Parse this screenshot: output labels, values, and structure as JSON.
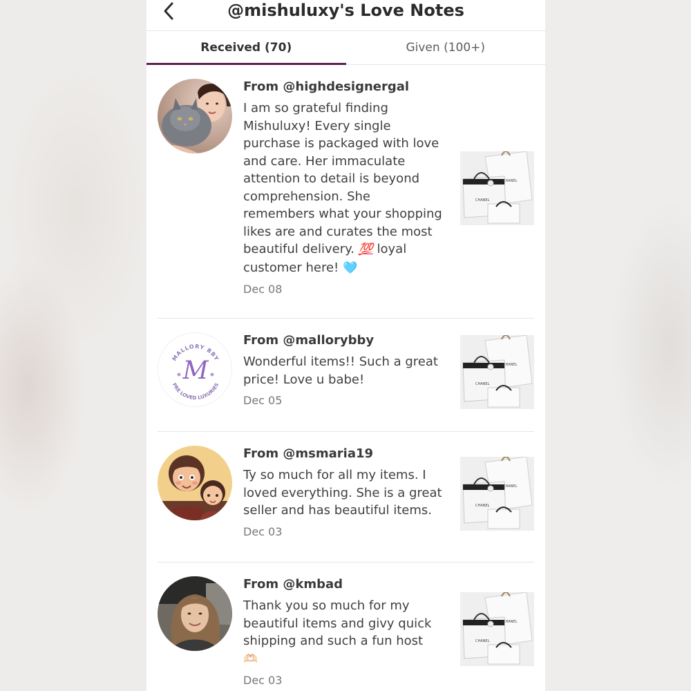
{
  "header": {
    "title": "@mishuluxy's Love Notes",
    "back_icon": "chevron-left-icon"
  },
  "tabs": [
    {
      "label": "Received (70)",
      "active": true
    },
    {
      "label": "Given (100+)",
      "active": false
    }
  ],
  "colors": {
    "accent": "#5c1f4f",
    "text": "#3f3f3f",
    "muted": "#777777"
  },
  "notes": [
    {
      "from": "From @highdesignergal",
      "message_lines": [
        "I am so grateful finding",
        "Mishuluxy! Every single",
        "purchase is packaged with love",
        "and care. Her immaculate",
        "attention to detail is beyond",
        "comprehension. She",
        "remembers what your shopping",
        "likes are and curates the most",
        "beautiful delivery. ",
        "customer here! "
      ],
      "emoji_100": "💯",
      "emoji_100_after": " loyal",
      "emoji_heart": "🩵",
      "date": "Dec 08",
      "avatar_icon": "woman-with-cat-avatar",
      "thumb_icon": "chanel-bags-photo"
    },
    {
      "from": "From @mallorybby",
      "message_lines": [
        "Wonderful items!! Such a great",
        "price! Love u babe!"
      ],
      "date": "Dec 05",
      "avatar_icon": "mallory-bby-logo-avatar",
      "avatar_logo": {
        "top": "MALLORY BBY",
        "letter": "M",
        "bottom": "PRE LOVED LUXURIES"
      },
      "thumb_icon": "chanel-bags-photo"
    },
    {
      "from": "From @msmaria19",
      "message_lines": [
        "Ty so much for all my items. I",
        "loved everything. She is a great",
        "seller and has beautiful items."
      ],
      "date": "Dec 03",
      "avatar_icon": "cartoon-mother-child-avatar",
      "thumb_icon": "chanel-bags-photo"
    },
    {
      "from": "From @kmbad",
      "message_lines": [
        "Thank you so much for my",
        "beautiful items and givy quick",
        "shipping and such a fun host"
      ],
      "emoji_hands": "🫶🏻",
      "date": "Dec 03",
      "avatar_icon": "woman-portrait-avatar",
      "thumb_icon": "chanel-bags-photo"
    }
  ]
}
